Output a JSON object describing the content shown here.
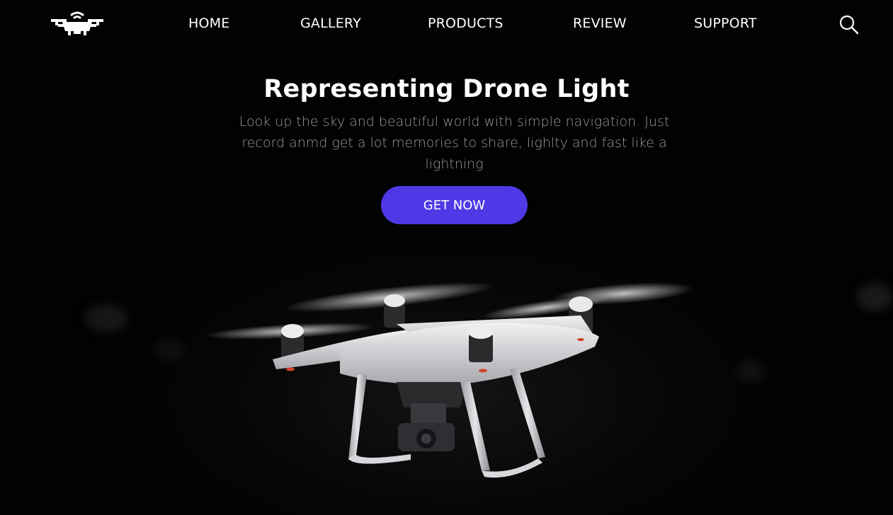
{
  "nav": {
    "items": [
      {
        "label": "HOME"
      },
      {
        "label": "GALLERY"
      },
      {
        "label": "PRODUCTS"
      },
      {
        "label": "REVIEW"
      },
      {
        "label": "SUPPORT"
      }
    ],
    "logo_icon": "drone-wifi-icon",
    "search_icon": "search-icon"
  },
  "hero": {
    "title": "Representing Drone Light",
    "subtitle": "Look up the sky and beautiful world with simple navigation. Just record anmd get a lot memories to share, lighlty and fast like a lightning",
    "cta_label": "GET NOW"
  },
  "colors": {
    "background": "#030303",
    "accent": "#4f39e6",
    "subtitle_text": "#9a9a9a"
  }
}
